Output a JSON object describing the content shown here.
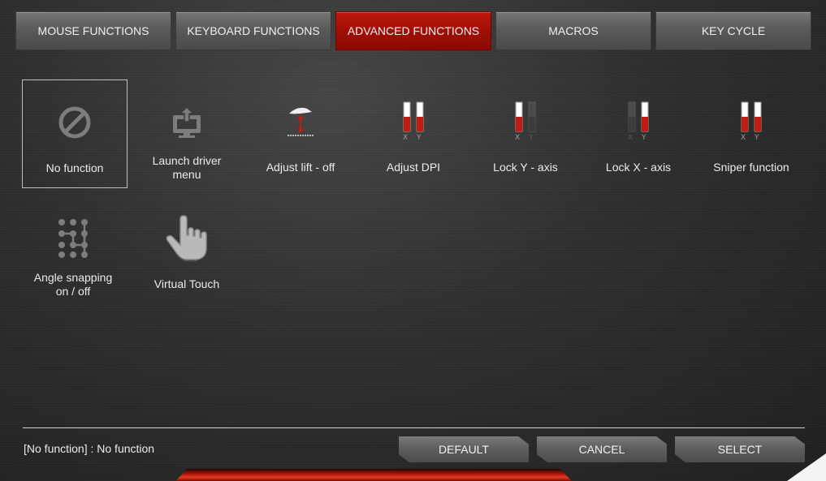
{
  "tabs": [
    {
      "label": "MOUSE FUNCTIONS",
      "active": false
    },
    {
      "label": "KEYBOARD FUNCTIONS",
      "active": false
    },
    {
      "label": "ADVANCED FUNCTIONS",
      "active": true
    },
    {
      "label": "MACROS",
      "active": false
    },
    {
      "label": "KEY CYCLE",
      "active": false
    }
  ],
  "functions": {
    "no_function": {
      "label": "No function",
      "icon": "no-entry-icon",
      "selected": true
    },
    "launch_driver": {
      "line1": "Launch driver",
      "line2": "menu",
      "icon": "launch-driver-icon"
    },
    "adjust_lift": {
      "label": "Adjust lift - off",
      "icon": "lift-adjust-icon"
    },
    "adjust_dpi": {
      "label": "Adjust DPI",
      "icon": "dpi-bars-icon",
      "axis_x": "X",
      "axis_y": "Y"
    },
    "lock_y": {
      "label": "Lock Y - axis",
      "icon": "lock-y-axis-icon",
      "axis_x": "X",
      "axis_y": "Y"
    },
    "lock_x": {
      "label": "Lock X - axis",
      "icon": "lock-x-axis-icon",
      "axis_x": "X",
      "axis_y": "Y"
    },
    "sniper": {
      "label": "Sniper function",
      "icon": "sniper-bars-icon",
      "axis_x": "X",
      "axis_y": "Y"
    },
    "angle_snapping": {
      "line1": "Angle snapping",
      "line2": "on / off",
      "icon": "angle-snapping-icon"
    },
    "virtual_touch": {
      "label": "Virtual Touch",
      "icon": "pointing-hand-icon"
    }
  },
  "footer": {
    "status": "[No function] : No function",
    "default_label": "DEFAULT",
    "cancel_label": "CANCEL",
    "select_label": "SELECT"
  },
  "colors": {
    "accent_red": "#c0170d",
    "tab_gray": "#5a5a5a",
    "icon_gray": "#7a7a7a"
  }
}
